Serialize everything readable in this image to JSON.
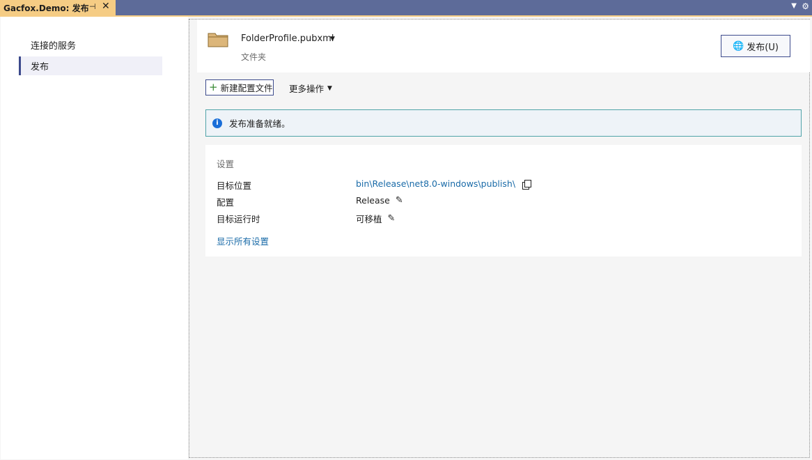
{
  "tab": {
    "title": "Gacfox.Demo: 发布",
    "pin_icon": "pin-icon",
    "close_icon": "close-icon"
  },
  "nav": {
    "items": [
      {
        "label": "连接的服务",
        "selected": false
      },
      {
        "label": "发布",
        "selected": true
      }
    ]
  },
  "profile": {
    "name": "FolderProfile.pubxml",
    "subtitle": "文件夹",
    "publish_label": "发布(U)"
  },
  "toolbar": {
    "new_profile_label": "新建配置文件",
    "more_actions_label": "更多操作"
  },
  "info": {
    "message": "发布准备就绪。"
  },
  "settings": {
    "title": "设置",
    "rows": [
      {
        "label": "目标位置",
        "value": "bin\\Release\\net8.0-windows\\publish\\"
      },
      {
        "label": "配置",
        "value": "Release"
      },
      {
        "label": "目标运行时",
        "value": "可移植"
      }
    ],
    "show_all_label": "显示所有设置"
  },
  "colors": {
    "tab_active": "#f5cc84",
    "tabstrip": "#5d6b99",
    "link": "#1a6ba8",
    "info_border": "#4fa3a8"
  }
}
